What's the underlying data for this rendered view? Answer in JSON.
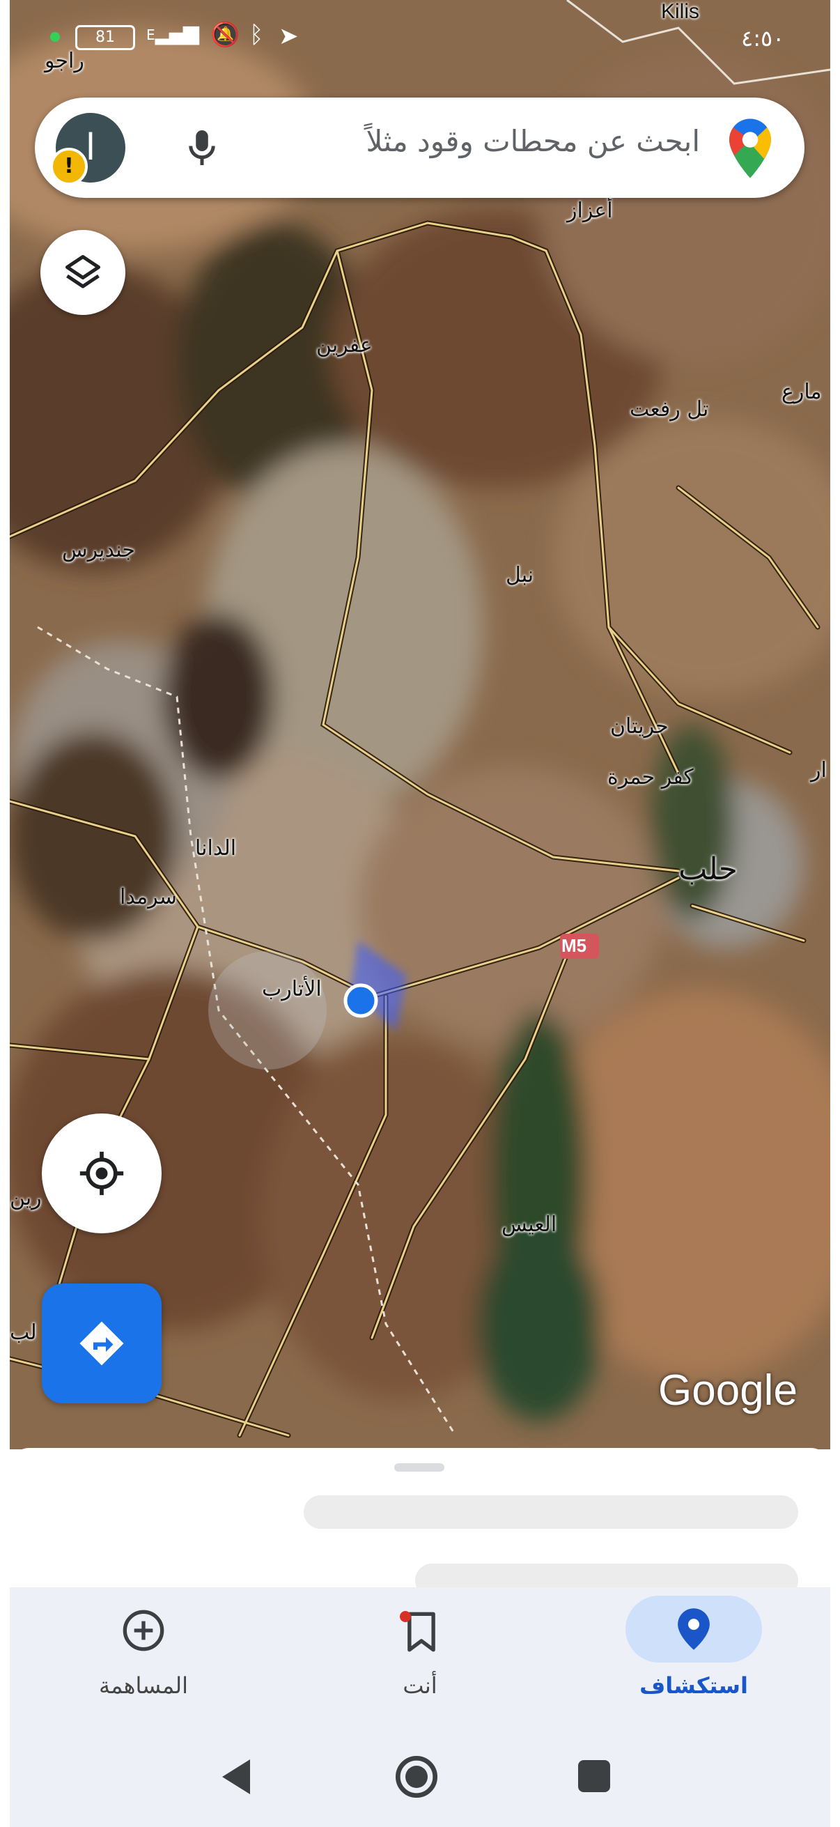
{
  "status_bar": {
    "time": "٤:٥٠",
    "battery": "81",
    "signal_label": "E"
  },
  "search": {
    "placeholder": "ابحث عن محطات وقود مثلاً",
    "avatar_letter": "ا",
    "warning_glyph": "!"
  },
  "map": {
    "labels": {
      "kilis": "Kilis",
      "rajo": "راجو",
      "azaz": "أعزاز",
      "afrin": "عفرين",
      "tal_rifat": "تل رفعت",
      "mare": "مارع",
      "jindires": "جنديرس",
      "nubl": "نبل",
      "hreitan": "حريتان",
      "kafr_hamra": "كفر حمرة",
      "aleppo": "حلب",
      "dana": "الدانا",
      "sarmada": "سرمدا",
      "atarib": "الأتارب",
      "eis": "العيس",
      "m5": "M5",
      "edge_left_1": "رين",
      "edge_left_2": "لب",
      "edge_right": "ار"
    },
    "attribution": "Google"
  },
  "bottom_nav": {
    "explore": "استكشاف",
    "you": "أنت",
    "contribute": "المساهمة"
  },
  "colors": {
    "accent": "#1a73e8",
    "active_pill": "#cfe0fb",
    "nav_bg": "#edf1f7"
  },
  "icons": [
    "layers-icon",
    "my-location-icon",
    "directions-icon",
    "mic-icon",
    "maps-pin-icon",
    "explore-pin-icon",
    "bookmark-icon",
    "add-circle-icon",
    "back-icon",
    "home-icon",
    "recents-icon"
  ]
}
